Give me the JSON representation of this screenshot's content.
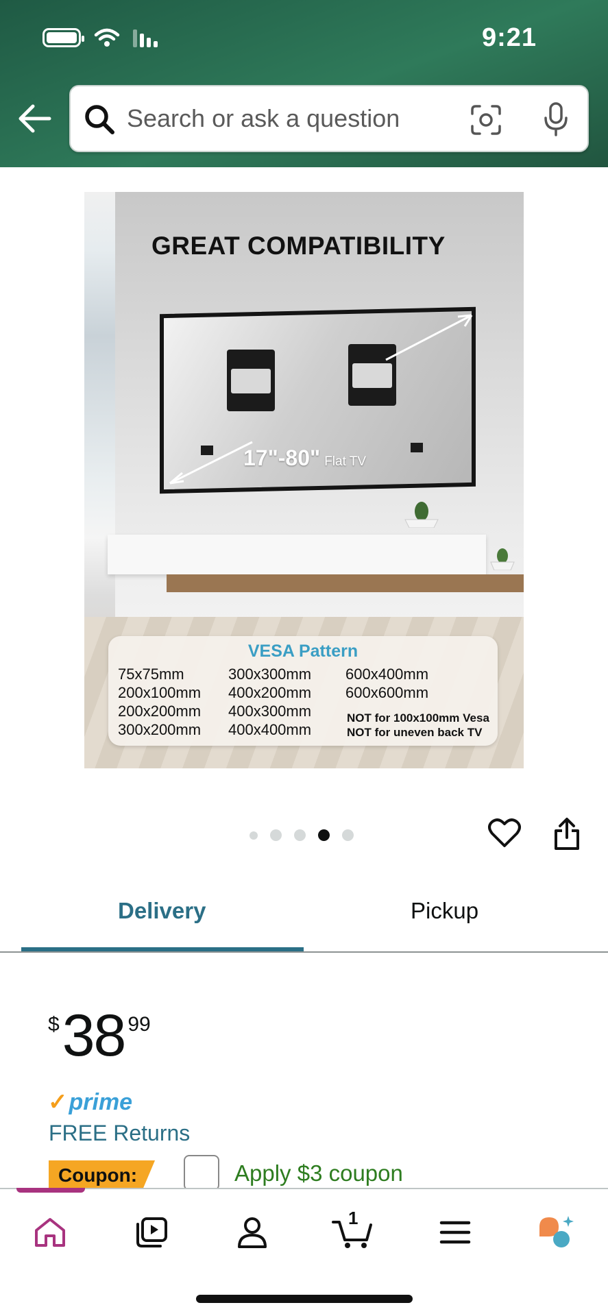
{
  "status_bar": {
    "time": "9:21"
  },
  "header": {
    "search_placeholder": "Search or ask a question"
  },
  "product_image": {
    "headline": "GREAT COMPATIBILITY",
    "tv_size": "17\"-80\"",
    "tv_size_suffix": "Flat TV",
    "vesa_title": "VESA Pattern",
    "vesa_col1": [
      "75x75mm",
      "200x100mm",
      "200x200mm",
      "300x200mm"
    ],
    "vesa_col2": [
      "300x300mm",
      "400x200mm",
      "400x300mm",
      "400x400mm"
    ],
    "vesa_col3": [
      "600x400mm",
      "600x600mm"
    ],
    "vesa_notes": [
      "NOT for 100x100mm Vesa",
      "NOT for uneven back TV"
    ]
  },
  "carousel": {
    "total": 5,
    "active_index": 4
  },
  "tabs": {
    "delivery": "Delivery",
    "pickup": "Pickup",
    "selected": "Delivery"
  },
  "price": {
    "symbol": "$",
    "whole": "38",
    "fraction": "99"
  },
  "prime_label": "prime",
  "free_returns": "FREE Returns",
  "coupon": {
    "badge": "Coupon:",
    "text": "Apply $3 coupon",
    "checked": false
  },
  "bottom_nav": {
    "items": [
      "home-icon",
      "video-icon",
      "account-icon",
      "cart-icon",
      "menu-icon",
      "rufus-icon"
    ],
    "cart_count": "1",
    "active": "home-icon"
  },
  "colors": {
    "header_green": "#2f7a5a",
    "link_teal": "#2b6f86",
    "prime_blue": "#3aa0d8",
    "coupon_orange": "#f5a623",
    "coupon_green": "#2e7d20",
    "nav_active": "#a8337f"
  }
}
